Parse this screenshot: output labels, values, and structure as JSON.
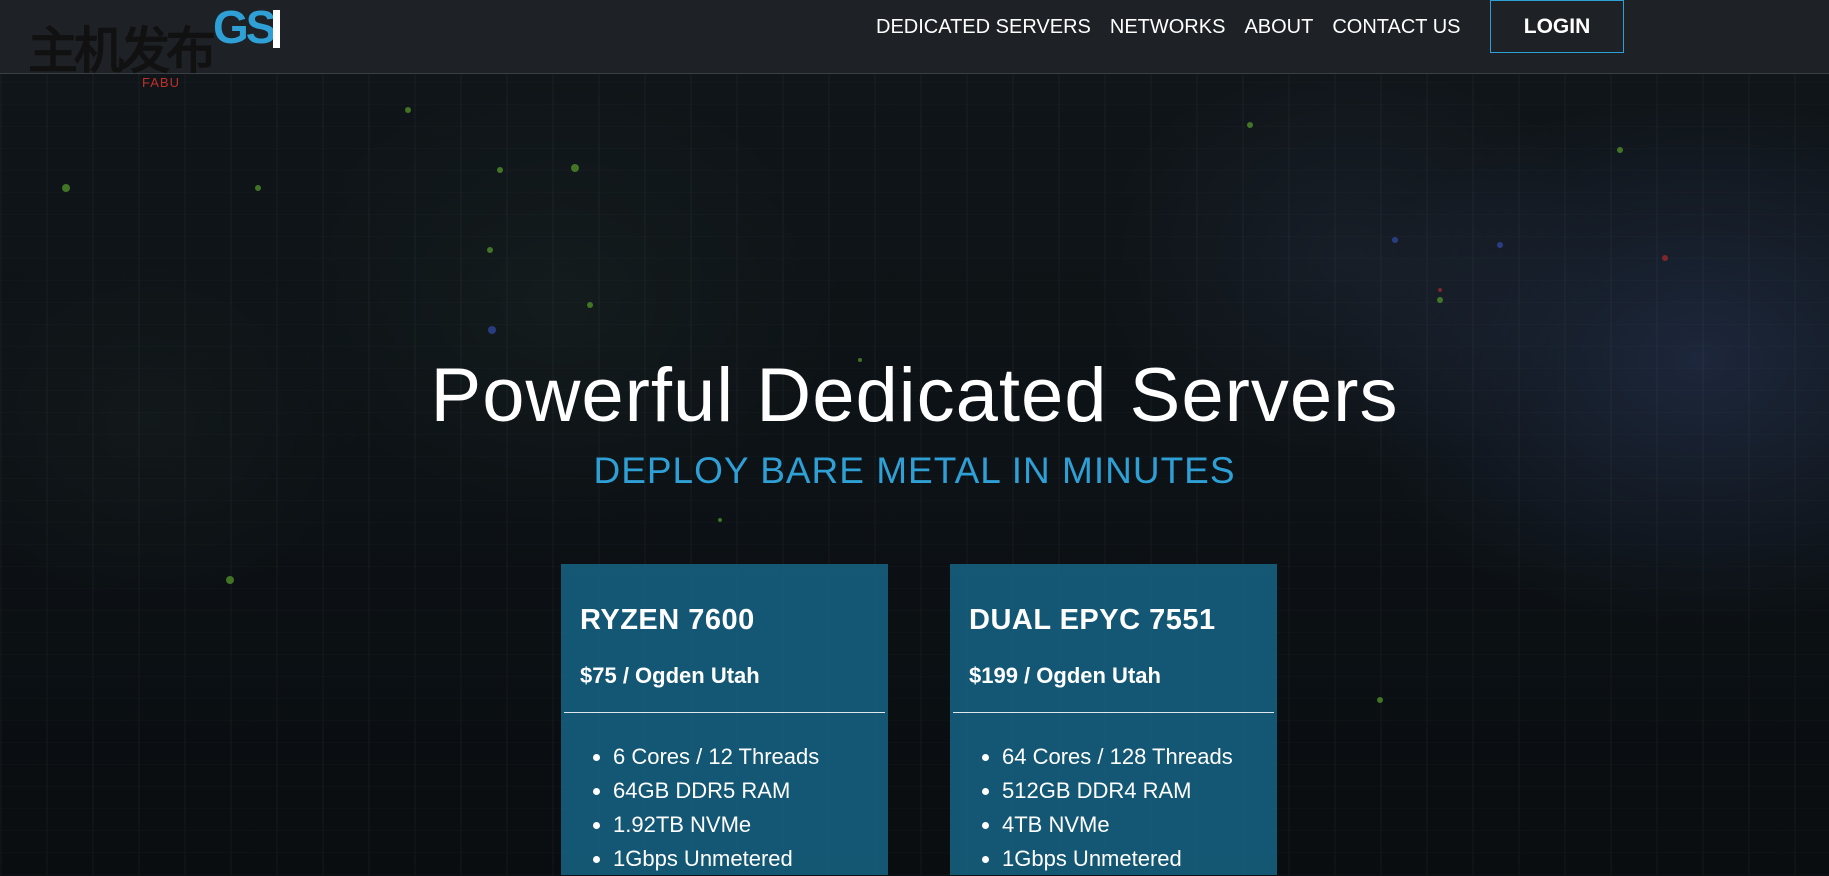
{
  "brand": {
    "cn_text": "主机发布",
    "gsi_text": "GS",
    "fabu_text": "FABU",
    "accent_color": "#2ea0d6"
  },
  "nav": {
    "links": [
      "DEDICATED SERVERS",
      "NETWORKS",
      "ABOUT",
      "CONTACT US"
    ],
    "login_label": "LOGIN"
  },
  "hero": {
    "title": "Powerful Dedicated Servers",
    "subtitle": "DEPLOY BARE METAL IN MINUTES"
  },
  "plans": [
    {
      "name": "RYZEN 7600",
      "price": "$75 / Ogden Utah",
      "specs": [
        "6 Cores / 12 Threads",
        "64GB DDR5 RAM",
        "1.92TB NVMe",
        "1Gbps Unmetered"
      ]
    },
    {
      "name": "DUAL EPYC 7551",
      "price": "$199 / Ogden Utah",
      "specs": [
        "64 Cores / 128 Threads",
        "512GB DDR4 RAM",
        "4TB NVMe",
        "1Gbps Unmetered"
      ]
    }
  ]
}
